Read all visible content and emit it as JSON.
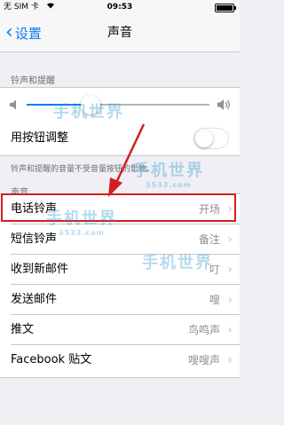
{
  "status_bar": {
    "carrier": "无 SIM 卡",
    "time": "09:53"
  },
  "nav": {
    "back_label": "设置",
    "title": "声音"
  },
  "ringer_section": {
    "header": "铃声和提醒",
    "volume_level": 0.35,
    "toggle_label": "用按钮调整",
    "toggle_on": false,
    "footer": "铃声和提醒的音量不受音量按钮的影响。"
  },
  "sounds_section": {
    "header": "声音",
    "rows": [
      {
        "label": "电话铃声",
        "value": "开场"
      },
      {
        "label": "短信铃声",
        "value": "备注"
      },
      {
        "label": "收到新邮件",
        "value": "叮"
      },
      {
        "label": "发送邮件",
        "value": "嗖"
      },
      {
        "label": "推文",
        "value": "鸟鸣声"
      },
      {
        "label": "Facebook 贴文",
        "value": "嗖嗖声"
      }
    ]
  },
  "watermark": {
    "brand": "手机世界",
    "site": "3533.com"
  },
  "colors": {
    "accent": "#0a7cf8",
    "highlight": "#d11f1f",
    "background": "#efeff4"
  }
}
